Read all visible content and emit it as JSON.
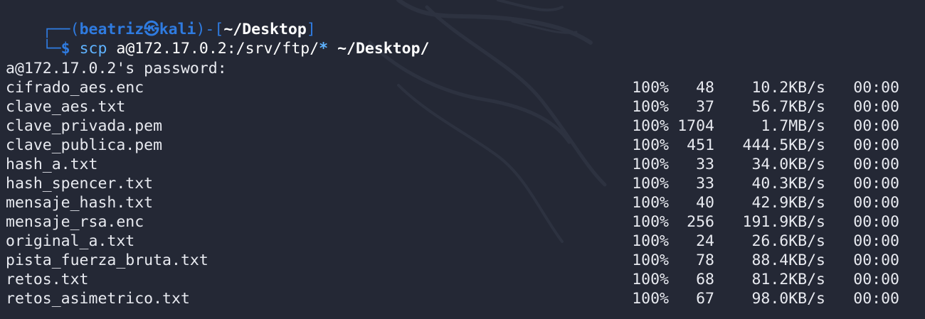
{
  "prompt": {
    "corner_top": "┌──(",
    "user": "beatriz",
    "at_symbol": "㉿",
    "host": "kali",
    "mid": ")-[",
    "cwd": "~/Desktop",
    "close": "]",
    "corner_bottom": "└─",
    "dollar": "$",
    "command": "scp",
    "arg_source": "a@172.17.0.2:/srv/ftp/",
    "arg_glob": "*",
    "arg_dest": "~/Desktop/"
  },
  "password_prompt": "a@172.17.0.2's password:",
  "transfers": [
    {
      "file": "cifrado_aes.enc",
      "percent": "100%",
      "size": "48",
      "rate": "10.2KB/s",
      "time": "00:00"
    },
    {
      "file": "clave_aes.txt",
      "percent": "100%",
      "size": "37",
      "rate": "56.7KB/s",
      "time": "00:00"
    },
    {
      "file": "clave_privada.pem",
      "percent": "100%",
      "size": "1704",
      "rate": "1.7MB/s",
      "time": "00:00"
    },
    {
      "file": "clave_publica.pem",
      "percent": "100%",
      "size": "451",
      "rate": "444.5KB/s",
      "time": "00:00"
    },
    {
      "file": "hash_a.txt",
      "percent": "100%",
      "size": "33",
      "rate": "34.0KB/s",
      "time": "00:00"
    },
    {
      "file": "hash_spencer.txt",
      "percent": "100%",
      "size": "33",
      "rate": "40.3KB/s",
      "time": "00:00"
    },
    {
      "file": "mensaje_hash.txt",
      "percent": "100%",
      "size": "40",
      "rate": "42.9KB/s",
      "time": "00:00"
    },
    {
      "file": "mensaje_rsa.enc",
      "percent": "100%",
      "size": "256",
      "rate": "191.9KB/s",
      "time": "00:00"
    },
    {
      "file": "original_a.txt",
      "percent": "100%",
      "size": "24",
      "rate": "26.6KB/s",
      "time": "00:00"
    },
    {
      "file": "pista_fuerza_bruta.txt",
      "percent": "100%",
      "size": "78",
      "rate": "88.4KB/s",
      "time": "00:00"
    },
    {
      "file": "retos.txt",
      "percent": "100%",
      "size": "68",
      "rate": "81.2KB/s",
      "time": "00:00"
    },
    {
      "file": "retos_asimetrico.txt",
      "percent": "100%",
      "size": "67",
      "rate": "98.0KB/s",
      "time": "00:00"
    }
  ],
  "colors": {
    "background": "#242835",
    "prompt_blue": "#2f7be0",
    "command_blue": "#5fb3ff",
    "text": "#e8eaf0"
  },
  "decor": {
    "watermark": "kali-dragon-icon"
  }
}
